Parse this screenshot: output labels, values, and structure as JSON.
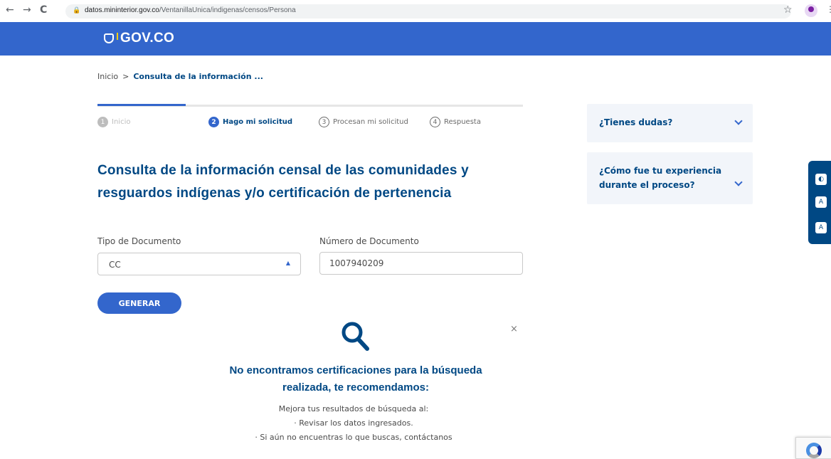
{
  "browser": {
    "url_domain": "datos.mininterior.gov.co",
    "url_path": "/VentanillaUnica/indigenas/censos/Persona"
  },
  "header": {
    "logo_text": "GOV.CO"
  },
  "breadcrumb": {
    "home": "Inicio",
    "separator": ">",
    "current": "Consulta de la información ..."
  },
  "steps": [
    {
      "number": "1",
      "label": "Inicio"
    },
    {
      "number": "2",
      "label": "Hago mi solicitud"
    },
    {
      "number": "3",
      "label": "Procesan mi solicitud"
    },
    {
      "number": "4",
      "label": "Respuesta"
    }
  ],
  "form": {
    "title": "Consulta de la información censal de las comunidades y resguardos indígenas y/o certificación de pertenencia",
    "doc_type_label": "Tipo de Documento",
    "doc_type_value": "CC",
    "doc_number_label": "Número de Documento",
    "doc_number_value": "1007940209",
    "submit_label": "GENERAR"
  },
  "result": {
    "title": "No encontramos certificaciones para la búsqueda realizada, te recomendamos:",
    "line1": "Mejora tus resultados de búsqueda al:",
    "line2": "· Revisar los datos ingresados.",
    "line3": "· Si aún no encuentras lo que buscas, contáctanos",
    "close": "×"
  },
  "sidebar": {
    "faq1": "¿Tienes dudas?",
    "faq2": "¿Cómo fue tu experiencia durante el proceso?"
  },
  "accessibility": {
    "contrast": "◐",
    "decrease": "A",
    "increase": "A"
  },
  "colors": {
    "brand_blue": "#3366cc",
    "title_blue": "#004884"
  }
}
